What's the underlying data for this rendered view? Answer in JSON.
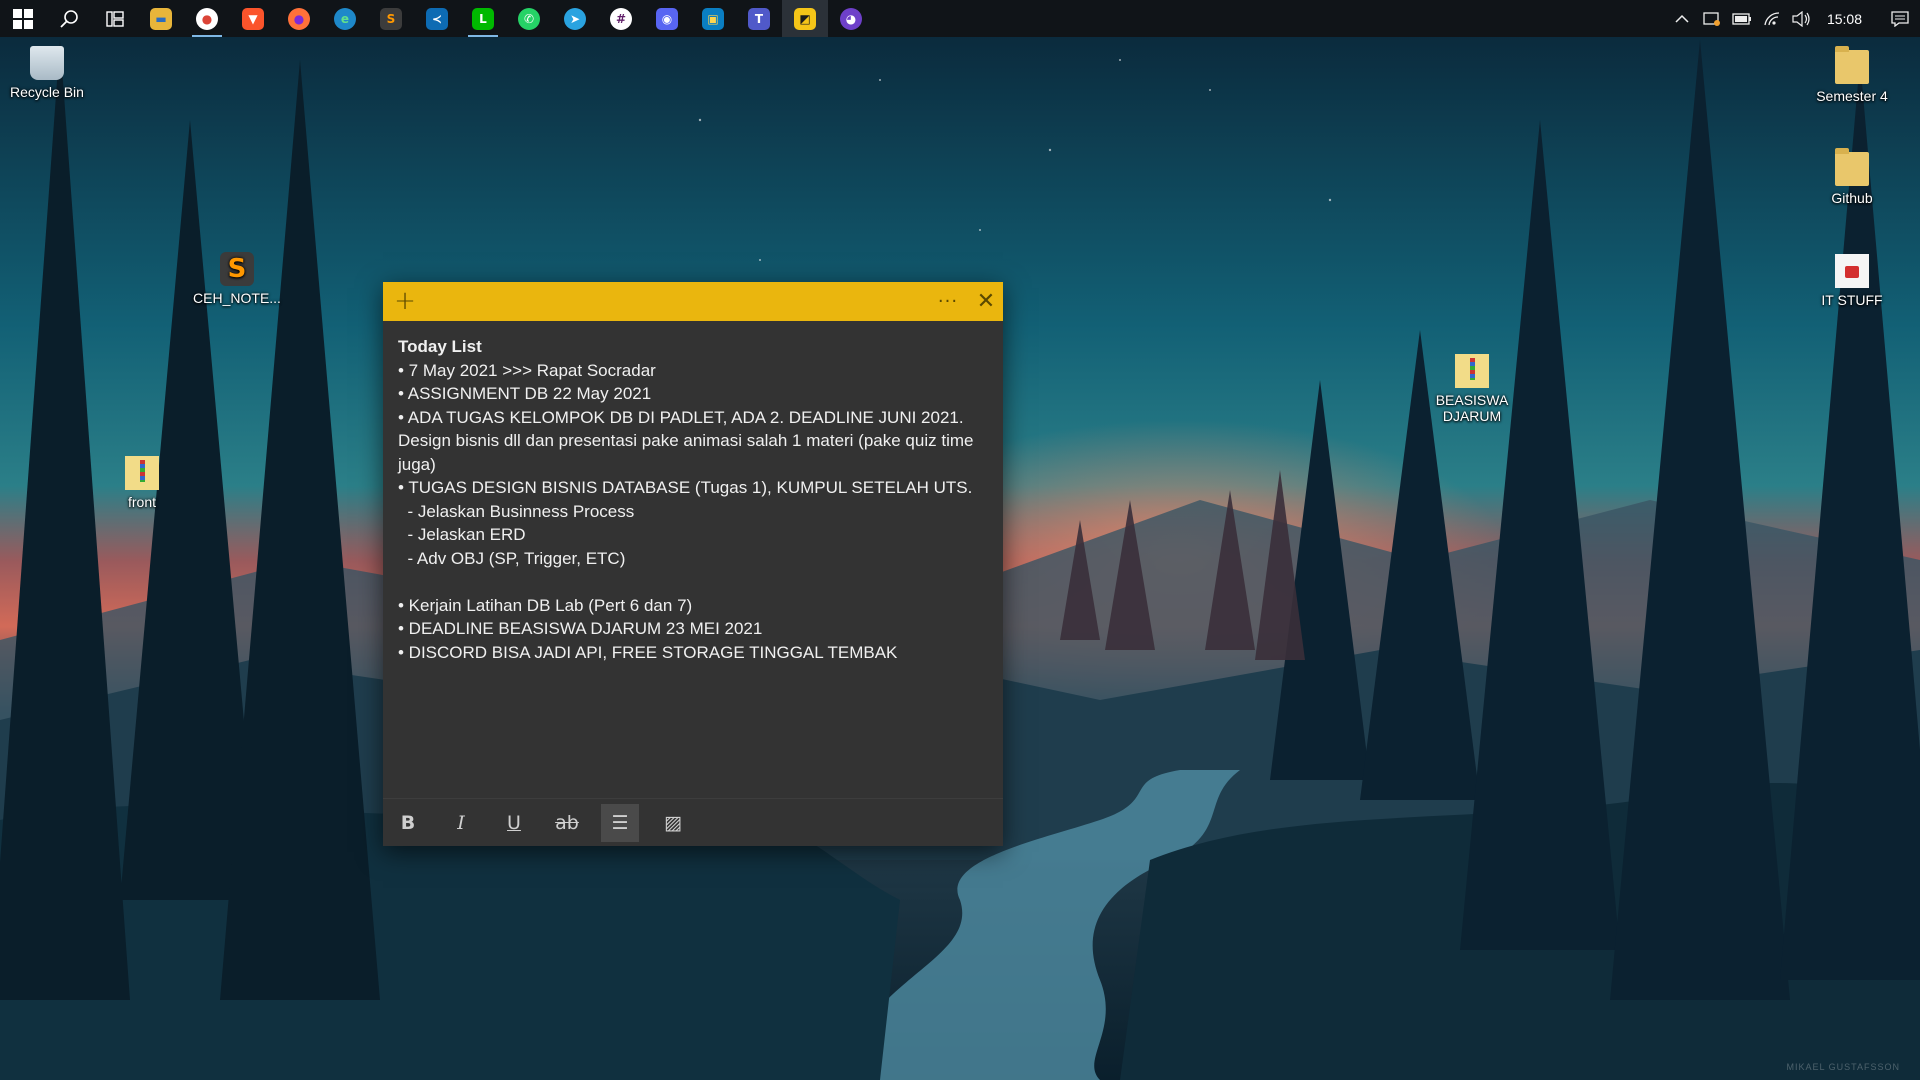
{
  "taskbar": {
    "apps": [
      {
        "name": "start",
        "glyph": "⊞",
        "bg": "transparent",
        "color": "#ffffff"
      },
      {
        "name": "search",
        "glyph": "⚲",
        "bg": "transparent",
        "color": "#ffffff"
      },
      {
        "name": "task-view",
        "glyph": "▤",
        "bg": "transparent",
        "color": "#ffffff"
      },
      {
        "name": "file-explorer",
        "glyph": "▬",
        "bg": "#e8b53a",
        "color": "#2a6cc0"
      },
      {
        "name": "chrome",
        "glyph": "●",
        "bg": "#ffffff",
        "color": "#db4437"
      },
      {
        "name": "brave",
        "glyph": "▼",
        "bg": "#fb542b",
        "color": "#ffffff"
      },
      {
        "name": "firefox",
        "glyph": "●",
        "bg": "#ff7139",
        "color": "#7d2ad8"
      },
      {
        "name": "edge",
        "glyph": "e",
        "bg": "#1e88c9",
        "color": "#62e08c"
      },
      {
        "name": "sublime",
        "glyph": "S",
        "bg": "#3c3c3c",
        "color": "#ff9800"
      },
      {
        "name": "vscode",
        "glyph": "≺",
        "bg": "#0d6bb3",
        "color": "#ffffff"
      },
      {
        "name": "line",
        "glyph": "L",
        "bg": "#00b900",
        "color": "#ffffff"
      },
      {
        "name": "whatsapp",
        "glyph": "✆",
        "bg": "#25d366",
        "color": "#ffffff"
      },
      {
        "name": "telegram",
        "glyph": "➤",
        "bg": "#2aa3e0",
        "color": "#ffffff"
      },
      {
        "name": "slack",
        "glyph": "#",
        "bg": "#ffffff",
        "color": "#611f69"
      },
      {
        "name": "discord",
        "glyph": "◉",
        "bg": "#5865f2",
        "color": "#ffffff"
      },
      {
        "name": "screen-sketch",
        "glyph": "▣",
        "bg": "#0a7ec2",
        "color": "#ffd54f"
      },
      {
        "name": "teams",
        "glyph": "T",
        "bg": "#5059c9",
        "color": "#ffffff"
      },
      {
        "name": "sticky-notes",
        "glyph": "◩",
        "bg": "#f5c518",
        "color": "#1c1c1c"
      },
      {
        "name": "github-desktop",
        "glyph": "◕",
        "bg": "#6e40c9",
        "color": "#ffffff"
      }
    ],
    "tray": {
      "chevron": "⌃",
      "time": "15:08"
    }
  },
  "desktop": {
    "icons": [
      {
        "label": "Recycle Bin"
      },
      {
        "label": "CEH_NOTE..."
      },
      {
        "label": "front"
      },
      {
        "label": "BEASISWA DJARUM"
      },
      {
        "label": "Semester 4"
      },
      {
        "label": "Github"
      },
      {
        "label": "IT STUFF"
      }
    ],
    "watermark": "MIKAEL GUSTAFSSON"
  },
  "note": {
    "plus": "+",
    "more": "···",
    "close": "✕",
    "title": "Today List",
    "lines": [
      "• 7 May 2021 >>> Rapat Socradar",
      "• ASSIGNMENT DB 22 May 2021",
      "• ADA TUGAS KELOMPOK DB DI PADLET, ADA 2. DEADLINE JUNI 2021.",
      "Design bisnis dll dan presentasi pake animasi salah 1 materi (pake quiz time",
      "juga)",
      "• TUGAS DESIGN BISNIS DATABASE (Tugas 1), KUMPUL SETELAH UTS.",
      "  - Jelaskan Businness Process",
      "  - Jelaskan ERD",
      "  - Adv OBJ (SP, Trigger, ETC)",
      "",
      "• Kerjain Latihan DB Lab (Pert 6 dan 7)",
      "• DEADLINE BEASISWA DJARUM 23 MEI 2021",
      "• DISCORD BISA JADI API, FREE STORAGE TINGGAL TEMBAK"
    ],
    "toolbar": {
      "bold": "B",
      "italic": "I",
      "underline": "U",
      "strike": "ab",
      "bullets": "☰",
      "image": "▨"
    }
  }
}
